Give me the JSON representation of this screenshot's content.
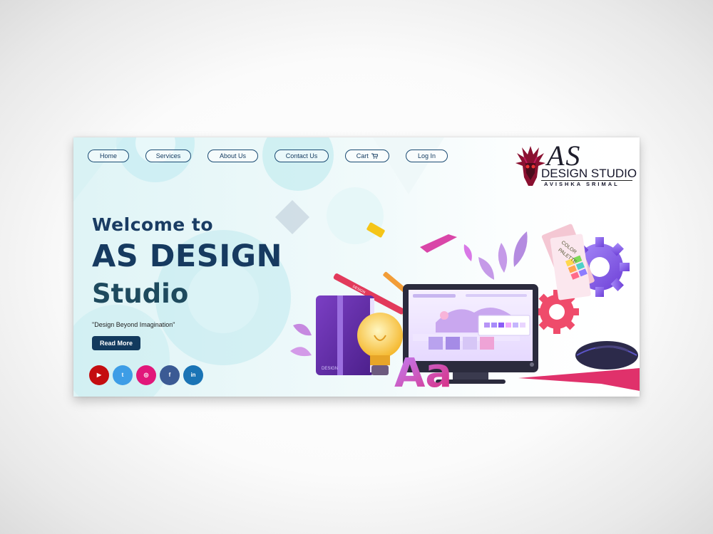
{
  "nav": {
    "home": "Home",
    "services": "Services",
    "about": "About Us",
    "contact": "Contact Us",
    "cart": "Cart",
    "login": "Log In"
  },
  "logo": {
    "monogram": "AS",
    "name": "DESIGN STUDIO",
    "owner": "AVISHKA SRIMAL"
  },
  "hero": {
    "welcome": "Welcome to",
    "title": "AS DESIGN",
    "studio": "Studio",
    "tagline": "\"Design Beyond Imagination\"",
    "cta": "Read More"
  },
  "illustration": {
    "palette_line1": "COLOR",
    "palette_line2": "PALETTE",
    "pencil_text": "DESIGN",
    "book_text": "DESIGN",
    "font_sample": "Aa"
  },
  "social": [
    {
      "name": "youtube",
      "glyph": "▶",
      "color": "#c40d10"
    },
    {
      "name": "twitter",
      "glyph": "t",
      "color": "#3d9de6"
    },
    {
      "name": "instagram",
      "glyph": "◎",
      "color": "#e1177a"
    },
    {
      "name": "facebook",
      "glyph": "f",
      "color": "#3b5a94"
    },
    {
      "name": "linkedin",
      "glyph": "in",
      "color": "#1a74b5"
    }
  ],
  "colors": {
    "navy": "#163a60",
    "accent_teal": "#a8e6ec",
    "button": "#123a5e"
  }
}
